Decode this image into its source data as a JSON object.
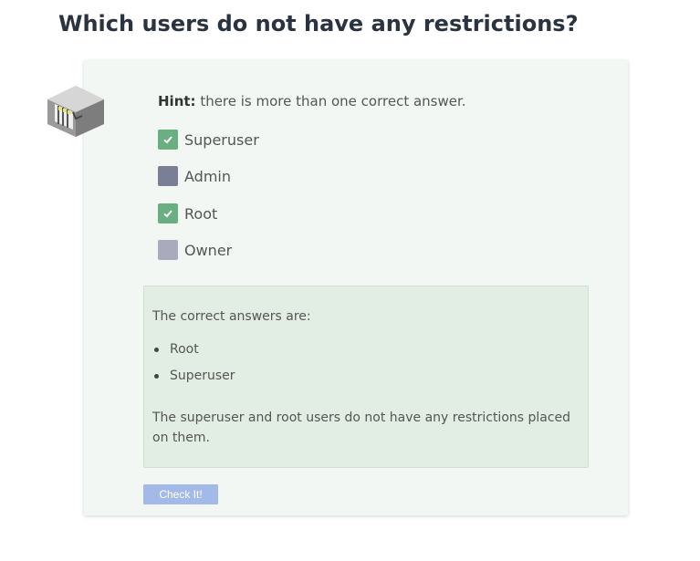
{
  "question": {
    "title": "Which users do not have any restrictions?"
  },
  "hint": {
    "label": "Hint:",
    "text": " there is more than one correct answer."
  },
  "options": [
    {
      "label": "Superuser",
      "checked": true,
      "color": "#6aaf82"
    },
    {
      "label": "Admin",
      "checked": false,
      "color": "#7b7f96"
    },
    {
      "label": "Root",
      "checked": true,
      "color": "#6aaf82"
    },
    {
      "label": "Owner",
      "checked": false,
      "color": "#a9abbd"
    }
  ],
  "feedback": {
    "intro": "The correct answers are:",
    "answers": [
      "Root",
      "Superuser"
    ],
    "explanation": "The superuser and root users do not have any restrictions placed on them."
  },
  "check_button": {
    "label": "Check It!",
    "color": "#a3b9e8"
  },
  "colors": {
    "card_background": "#f2f7f3",
    "feedback_background": "#e2ede3",
    "checked": "#6aaf82"
  },
  "icons": {
    "illustration": "server-rack-icon",
    "checkmark": "checkmark-icon"
  }
}
